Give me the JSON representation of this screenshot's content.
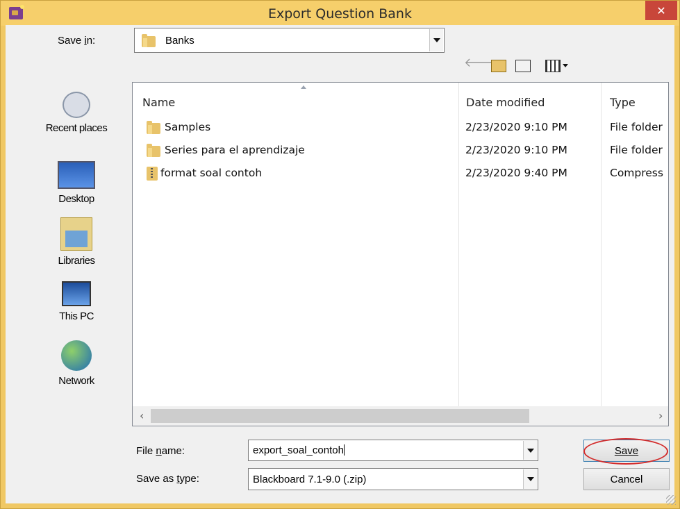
{
  "window": {
    "title": "Export Question Bank",
    "close_glyph": "✕"
  },
  "save_in": {
    "label": "Save in:",
    "value": "Banks"
  },
  "toolbar": {
    "icons": [
      "back-arrow-icon",
      "up-folder-icon",
      "new-folder-icon",
      "view-menu-icon"
    ]
  },
  "places": [
    {
      "label": "Recent places",
      "icon": "recent-places-icon"
    },
    {
      "label": "Desktop",
      "icon": "desktop-icon"
    },
    {
      "label": "Libraries",
      "icon": "libraries-icon"
    },
    {
      "label": "This PC",
      "icon": "this-pc-icon"
    },
    {
      "label": "Network",
      "icon": "network-icon"
    }
  ],
  "columns": [
    "Name",
    "Date modified",
    "Type"
  ],
  "files": [
    {
      "name": "Samples",
      "date": "2/23/2020 9:10 PM",
      "type": "File folder",
      "icon": "folder-icon"
    },
    {
      "name": "Series para el aprendizaje",
      "date": "2/23/2020 9:10 PM",
      "type": "File folder",
      "icon": "folder-icon"
    },
    {
      "name": "format soal contoh",
      "date": "2/23/2020 9:40 PM",
      "type": "Compress",
      "icon": "zip-folder-icon"
    }
  ],
  "file_name": {
    "label": "File name:",
    "value": "export_soal_contoh"
  },
  "save_as_type": {
    "label": "Save as type:",
    "value": "Blackboard 7.1-9.0 (.zip)"
  },
  "buttons": {
    "save": "Save",
    "cancel": "Cancel"
  },
  "colors": {
    "title_bar": "#f6cf6b",
    "close_button": "#c8463a",
    "highlight_oval": "#d22b2b"
  }
}
